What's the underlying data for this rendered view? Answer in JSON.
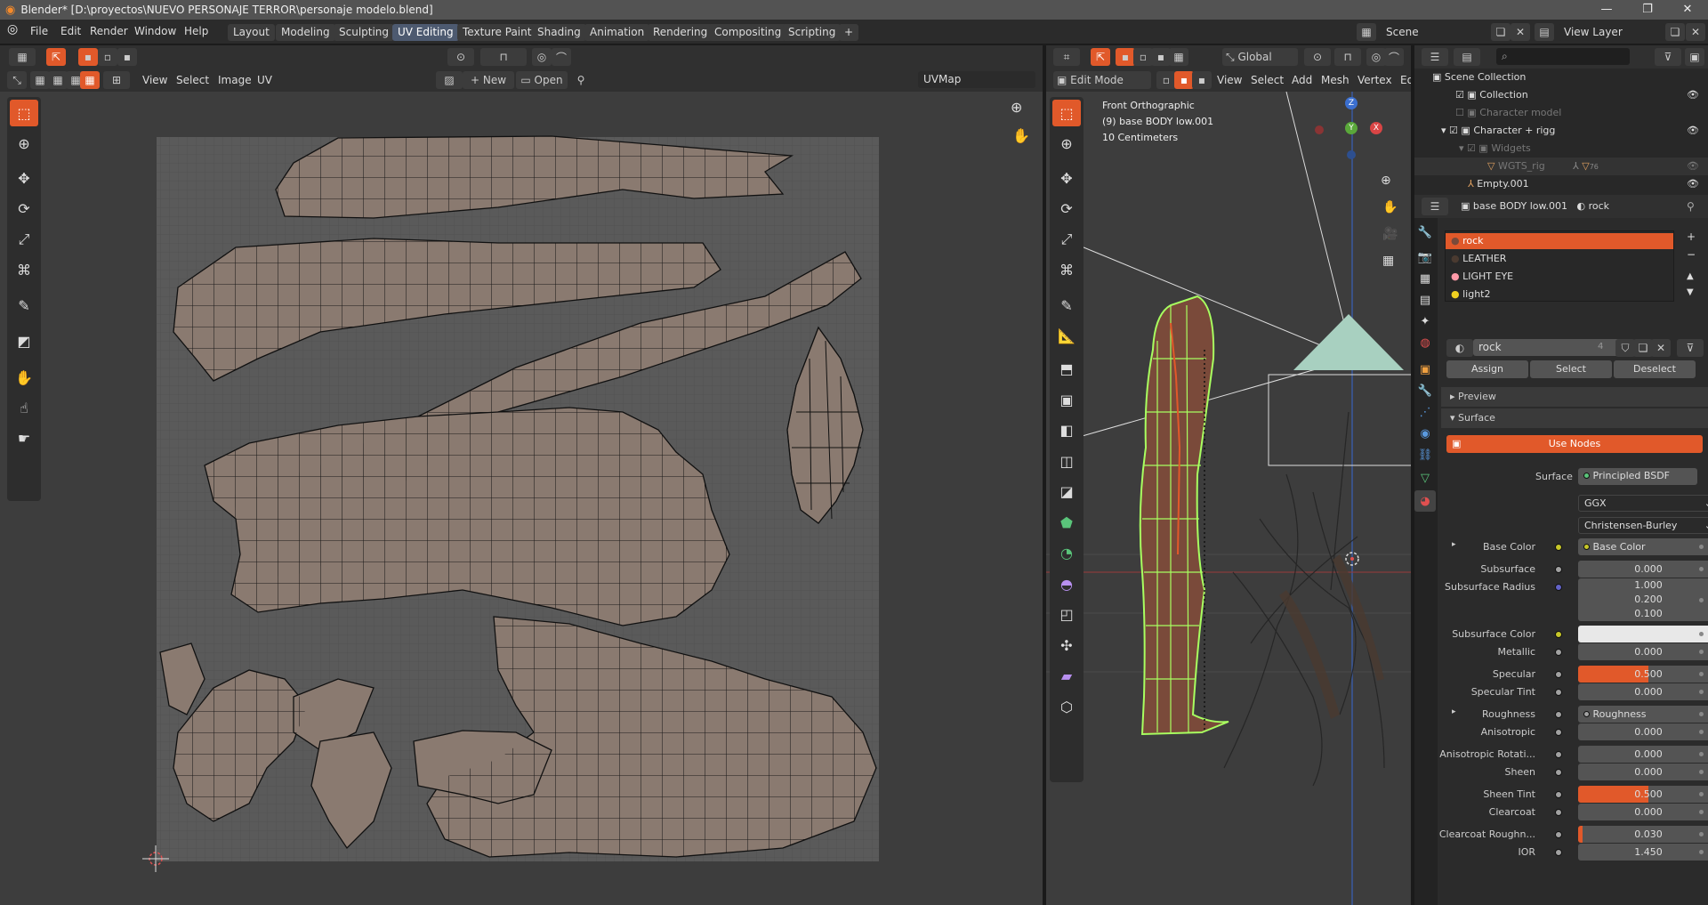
{
  "window": {
    "title": "Blender* [D:\\proyectos\\NUEVO PERSONAJE TERROR\\personaje  modelo.blend]",
    "minimize": "—",
    "maximize": "❐",
    "close": "✕"
  },
  "menu": [
    "File",
    "Edit",
    "Render",
    "Window",
    "Help"
  ],
  "workspaces": [
    "Layout",
    "Modeling",
    "Sculpting",
    "UV Editing",
    "Texture Paint",
    "Shading",
    "Animation",
    "Rendering",
    "Compositing",
    "Scripting"
  ],
  "active_workspace": "UV Editing",
  "add_workspace": "+",
  "scene": {
    "label": "Scene",
    "view_layer": "View Layer"
  },
  "uv_editor": {
    "menus": [
      "View",
      "Select",
      "Image",
      "UV"
    ],
    "new_label": "New",
    "open_label": "Open",
    "uvmap": "UVMap"
  },
  "viewport": {
    "mode": "Edit Mode",
    "orientation": "Global",
    "menus": [
      "View",
      "Select",
      "Add",
      "Mesh",
      "Vertex",
      "Ed"
    ],
    "overlay_line1": "Front Orthographic",
    "overlay_line2": "(9) base BODY low.001",
    "overlay_line3": "10 Centimeters",
    "gizmo": {
      "z": "Z",
      "y": "Y",
      "x": "X"
    }
  },
  "outliner": {
    "search_placeholder": "",
    "rows": [
      {
        "label": "Scene Collection"
      },
      {
        "label": "Collection"
      },
      {
        "label": "Character model"
      },
      {
        "label": "Character + rigg"
      },
      {
        "label": "Widgets"
      },
      {
        "label": "WGTS_rig"
      },
      {
        "label": "Empty.001"
      }
    ],
    "wgts_count": "76"
  },
  "properties": {
    "object_name": "base BODY low.001",
    "material_name": "rock",
    "material_slots": [
      {
        "name": "rock",
        "color": "#7a4a3a"
      },
      {
        "name": "LEATHER",
        "color": "#4a3a30"
      },
      {
        "name": "LIGHT EYE",
        "color": "#ff9aa8"
      },
      {
        "name": "light2",
        "color": "#f0d020"
      }
    ],
    "users": "4",
    "assign_label": "Assign",
    "select_label": "Select",
    "deselect_label": "Deselect",
    "preview_label": "Preview",
    "surface_panel_label": "Surface",
    "use_nodes_label": "Use Nodes",
    "surface_label": "Surface",
    "surface_shader": "Principled BSDF",
    "distribution": "GGX",
    "subsurface_method": "Christensen-Burley",
    "fields": [
      {
        "label": "Base Color",
        "value": "Base Color",
        "kind": "link",
        "sock": "#c7c729"
      },
      {
        "label": "Subsurface",
        "value": "0.000",
        "kind": "num",
        "sock": "#a1a1a1",
        "fill": 0
      },
      {
        "label": "Subsurface Radius",
        "values": [
          "1.000",
          "0.200",
          "0.100"
        ],
        "kind": "vec",
        "sock": "#6363c7"
      },
      {
        "label": "Subsurface Color",
        "value": "",
        "kind": "color",
        "sock": "#c7c729"
      },
      {
        "label": "Metallic",
        "value": "0.000",
        "kind": "num",
        "sock": "#a1a1a1",
        "fill": 0
      },
      {
        "label": "Specular",
        "value": "0.500",
        "kind": "num",
        "sock": "#a1a1a1",
        "fill": 0.5
      },
      {
        "label": "Specular Tint",
        "value": "0.000",
        "kind": "num",
        "sock": "#a1a1a1",
        "fill": 0
      },
      {
        "label": "Roughness",
        "value": "Roughness",
        "kind": "link",
        "sock": "#a1a1a1"
      },
      {
        "label": "Anisotropic",
        "value": "0.000",
        "kind": "num",
        "sock": "#a1a1a1",
        "fill": 0
      },
      {
        "label": "Anisotropic Rotati...",
        "value": "0.000",
        "kind": "num",
        "sock": "#a1a1a1",
        "fill": 0
      },
      {
        "label": "Sheen",
        "value": "0.000",
        "kind": "num",
        "sock": "#a1a1a1",
        "fill": 0
      },
      {
        "label": "Sheen Tint",
        "value": "0.500",
        "kind": "num",
        "sock": "#a1a1a1",
        "fill": 0.5
      },
      {
        "label": "Clearcoat",
        "value": "0.000",
        "kind": "num",
        "sock": "#a1a1a1",
        "fill": 0
      },
      {
        "label": "Clearcoat Roughn...",
        "value": "0.030",
        "kind": "num",
        "sock": "#a1a1a1",
        "fill": 0.03
      },
      {
        "label": "IOR",
        "value": "1.450",
        "kind": "num",
        "sock": "#a1a1a1",
        "fill": 0
      }
    ]
  },
  "colors": {
    "accent": "#e1592a",
    "uv_face": "#8a7a70",
    "mesh_select": "#a8ff60",
    "active_workspace": "#4d5a70"
  }
}
